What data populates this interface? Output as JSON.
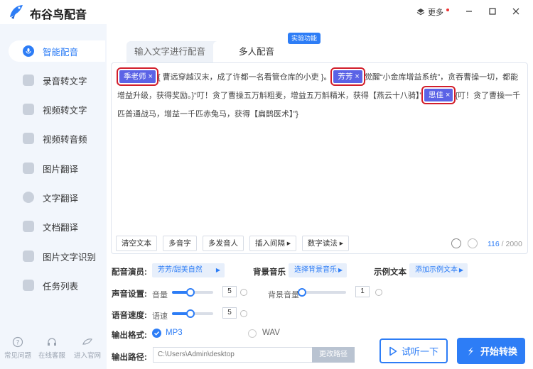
{
  "app": {
    "title": "布谷鸟配音",
    "more_label": "更多"
  },
  "sidebar": {
    "items": [
      {
        "label": "智能配音"
      },
      {
        "label": "录音转文字"
      },
      {
        "label": "视频转文字"
      },
      {
        "label": "视频转音频"
      },
      {
        "label": "图片翻译"
      },
      {
        "label": "文字翻译"
      },
      {
        "label": "文档翻译"
      },
      {
        "label": "图片文字识别"
      },
      {
        "label": "任务列表"
      }
    ],
    "bottom": [
      {
        "label": "常见问题"
      },
      {
        "label": "在线客服"
      },
      {
        "label": "进入官网"
      }
    ]
  },
  "tabs": {
    "tab1": "输入文字进行配音",
    "tab2": "多人配音",
    "badge": "实验功能"
  },
  "editor": {
    "tag1": "季老师",
    "seg1": "{ 曹远穿越汉末，成了许都一名看管仓库的小吏 }。",
    "tag2": "芳芳",
    "seg2": "觉醒“小金库增益系统”，贪吞曹操一切，都能增益升级，获得奖励。}“叮！贪了曹操五万斛粗麦，增益五万斛精米，获得【燕云十八骑】”",
    "tag3": "思佳",
    "seg3": "{叮！贪了曹操一千匹普通战马，增益一千匹赤兔马，获得【扁鹊医术】”}",
    "close": "×"
  },
  "toolbar": {
    "clear": "清空文本",
    "polyphone": "多音字",
    "multi_speaker": "多发音人",
    "insert_pause": "插入间隔 ▸",
    "number_read": "数字读法 ▸",
    "count": "116",
    "total": "/ 2000"
  },
  "settings": {
    "voice_label": "配音演员:",
    "voice_value": "芳芳/甜美自然",
    "bgm_label": "背景音乐",
    "bgm_value": "选择背景音乐",
    "sample_label": "示例文本",
    "sample_value": "添加示例文本",
    "sound_label": "声音设置:",
    "volume_label": "音量",
    "volume_value": "5",
    "bg_volume_label": "背景音量",
    "bg_volume_value": "1",
    "speed_label": "语音速度:",
    "speed_sub": "语速",
    "speed_value": "5",
    "format_label": "输出格式:",
    "format_mp3": "MP3",
    "format_wav": "WAV",
    "path_label": "输出路径:",
    "path_value": "C:\\Users\\Admin\\desktop",
    "path_button": "更改路径"
  },
  "actions": {
    "preview": "试听一下",
    "convert": "开始转换"
  },
  "levels": {
    "volume_pct": 0.45,
    "bg_volume_pct": 0.0,
    "speed_pct": 0.45
  },
  "colors": {
    "accent": "#2d7df6",
    "tag": "#5b63e6",
    "highlight": "#d21e2b"
  }
}
